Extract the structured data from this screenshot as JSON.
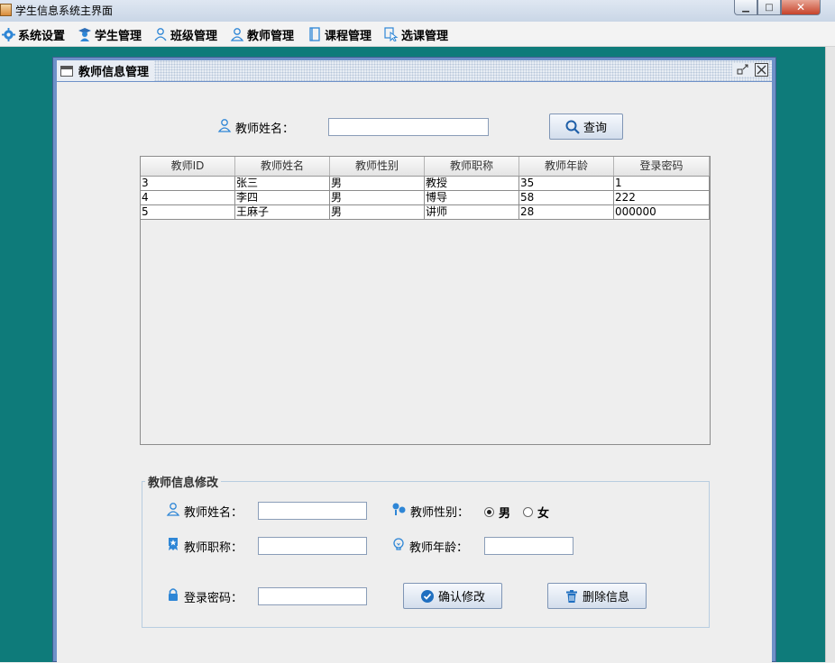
{
  "window": {
    "title": "学生信息系统主界面"
  },
  "menu": [
    {
      "label": "系统设置",
      "icon": "gear-icon"
    },
    {
      "label": "学生管理",
      "icon": "student-icon"
    },
    {
      "label": "班级管理",
      "icon": "class-icon"
    },
    {
      "label": "教师管理",
      "icon": "teacher-icon"
    },
    {
      "label": "课程管理",
      "icon": "book-icon"
    },
    {
      "label": "选课管理",
      "icon": "select-icon"
    }
  ],
  "frame": {
    "title": "教师信息管理"
  },
  "search": {
    "label": "教师姓名：",
    "value": "",
    "button": "查询"
  },
  "table": {
    "columns": [
      "教师ID",
      "教师姓名",
      "教师性别",
      "教师职称",
      "教师年龄",
      "登录密码"
    ],
    "rows": [
      [
        "3",
        "张三",
        "男",
        "教授",
        "35",
        "1"
      ],
      [
        "4",
        "李四",
        "男",
        "博导",
        "58",
        "222"
      ],
      [
        "5",
        "王麻子",
        "男",
        "讲师",
        "28",
        "000000"
      ]
    ]
  },
  "edit": {
    "group_title": "教师信息修改",
    "name_label": "教师姓名：",
    "gender_label": "教师性别：",
    "gender_options": [
      "男",
      "女"
    ],
    "gender_selected": "男",
    "title_label": "教师职称：",
    "age_label": "教师年龄：",
    "password_label": "登录密码：",
    "confirm_button": "确认修改",
    "delete_button": "删除信息"
  }
}
